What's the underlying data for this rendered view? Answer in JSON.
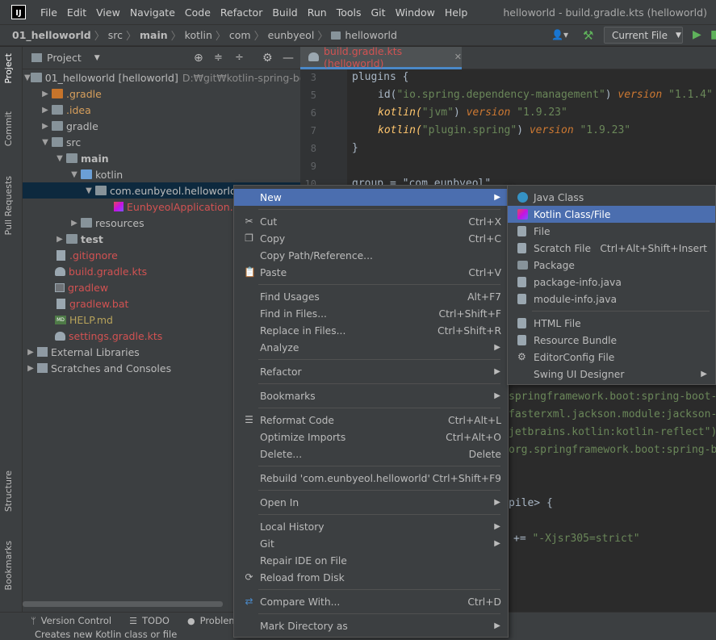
{
  "titlebar": {
    "menus": [
      "File",
      "Edit",
      "View",
      "Navigate",
      "Code",
      "Refactor",
      "Build",
      "Run",
      "Tools",
      "Git",
      "Window",
      "Help"
    ],
    "window_title": "helloworld - build.gradle.kts (helloworld)"
  },
  "navbar": {
    "breadcrumbs": [
      "01_helloworld",
      "src",
      "main",
      "kotlin",
      "com",
      "eunbyeol",
      "helloworld"
    ],
    "run_config": "Current File"
  },
  "left_strip": {
    "tabs": [
      "Project",
      "Commit",
      "Pull Requests",
      "Structure",
      "Bookmarks"
    ]
  },
  "project": {
    "title": "Project",
    "tree": [
      {
        "label": "01_helloworld [helloworld]",
        "extra": "D:₩git₩kotlin-spring-boot-c"
      },
      {
        "label": ".gradle"
      },
      {
        "label": ".idea"
      },
      {
        "label": "gradle"
      },
      {
        "label": "src"
      },
      {
        "label": "main"
      },
      {
        "label": "kotlin"
      },
      {
        "label": "com.eunbyeol.helloworld"
      },
      {
        "label": "EunbyeolApplication.kt"
      },
      {
        "label": "resources"
      },
      {
        "label": "test"
      },
      {
        "label": ".gitignore"
      },
      {
        "label": "build.gradle.kts"
      },
      {
        "label": "gradlew"
      },
      {
        "label": "gradlew.bat"
      },
      {
        "label": "HELP.md"
      },
      {
        "label": "settings.gradle.kts"
      },
      {
        "label": "External Libraries"
      },
      {
        "label": "Scratches and Consoles"
      }
    ]
  },
  "editor": {
    "tab_label": "build.gradle.kts (helloworld)",
    "line_numbers": [
      "3",
      "5",
      "6",
      "7",
      "8",
      "9",
      "10"
    ],
    "code": {
      "l3": "plugins {",
      "l5a": "id(",
      "l5b": "\"io.spring.dependency-management\"",
      "l5c": ") ",
      "l5d": "version",
      "l5e": " \"1.1.4\"",
      "l6a": "kotlin(",
      "l6b": "\"jvm\"",
      "l6c": ") ",
      "l6d": "version",
      "l6e": " \"1.9.23\"",
      "l7a": "kotlin(",
      "l7b": "\"plugin.spring\"",
      "l7c": ") ",
      "l7d": "version",
      "l7e": " \"1.9.23\"",
      "l8": "}",
      "l10": "group = \"com.eunbyeol\"",
      "r1": "springframework.boot:spring-boot-",
      "r2": "fasterxml.jackson.module:jackson-",
      "r3": "jetbrains.kotlin:kotlin-reflect\")",
      "r4": "org.springframework.boot:spring-b",
      "r5a": "pile> {",
      "r6a": "+= ",
      "r6b": "\"-Xjsr305=strict\""
    }
  },
  "context_menu": {
    "new": "New",
    "cut": "Cut",
    "cut_sc": "Ctrl+X",
    "copy": "Copy",
    "copy_sc": "Ctrl+C",
    "copy_path": "Copy Path/Reference...",
    "paste": "Paste",
    "paste_sc": "Ctrl+V",
    "find_usages": "Find Usages",
    "find_usages_sc": "Alt+F7",
    "find_in_files": "Find in Files...",
    "find_in_files_sc": "Ctrl+Shift+F",
    "replace_in_files": "Replace in Files...",
    "replace_in_files_sc": "Ctrl+Shift+R",
    "analyze": "Analyze",
    "refactor": "Refactor",
    "bookmarks": "Bookmarks",
    "reformat": "Reformat Code",
    "reformat_sc": "Ctrl+Alt+L",
    "optimize": "Optimize Imports",
    "optimize_sc": "Ctrl+Alt+O",
    "delete": "Delete...",
    "delete_sc": "Delete",
    "rebuild": "Rebuild 'com.eunbyeol.helloworld'",
    "rebuild_sc": "Ctrl+Shift+F9",
    "open_in": "Open In",
    "local_history": "Local History",
    "git": "Git",
    "repair": "Repair IDE on File",
    "reload": "Reload from Disk",
    "compare": "Compare With...",
    "compare_sc": "Ctrl+D",
    "mark_dir": "Mark Directory as"
  },
  "submenu": {
    "java_class": "Java Class",
    "kotlin_class": "Kotlin Class/File",
    "file": "File",
    "scratch": "Scratch File",
    "scratch_sc": "Ctrl+Alt+Shift+Insert",
    "package": "Package",
    "package_info": "package-info.java",
    "module_info": "module-info.java",
    "html_file": "HTML File",
    "resource_bundle": "Resource Bundle",
    "editorconfig": "EditorConfig File",
    "swing": "Swing UI Designer"
  },
  "bottom": {
    "tabs": [
      "Version Control",
      "TODO",
      "Problems"
    ]
  },
  "status": {
    "text": "Creates new Kotlin class or file"
  },
  "colors": {
    "accent": "#4b6eaf",
    "panel": "#3c3f41",
    "editor": "#2b2b2b"
  }
}
